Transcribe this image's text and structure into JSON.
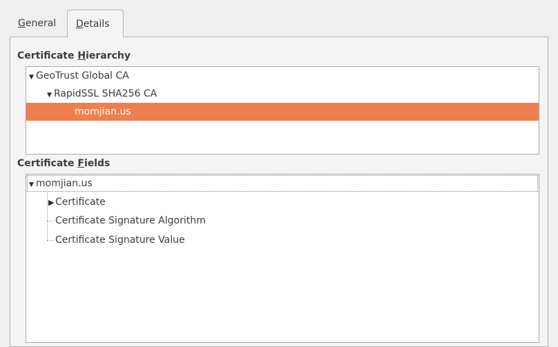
{
  "tabs": [
    {
      "label_u": "G",
      "label_rest": "eneral"
    },
    {
      "label_u": "D",
      "label_rest": "etails"
    }
  ],
  "hierarchy": {
    "title_pre": "Certificate ",
    "title_u": "H",
    "title_post": "ierarchy",
    "items": [
      "GeoTrust Global CA",
      "RapidSSL SHA256 CA",
      "momjian.us"
    ]
  },
  "fields": {
    "title_pre": "Certificate ",
    "title_u": "F",
    "title_post": "ields",
    "root": "momjian.us",
    "children": [
      "Certificate",
      "Certificate Signature Algorithm",
      "Certificate Signature Value"
    ]
  },
  "colors": {
    "selection": "#f07f4e",
    "focus_outline": "#c86a3c"
  }
}
